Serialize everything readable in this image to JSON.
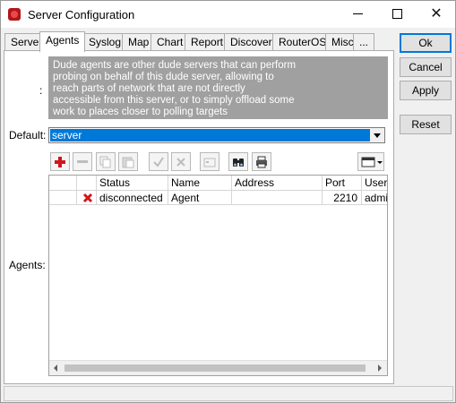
{
  "window": {
    "title": "Server Configuration"
  },
  "titlebar": {
    "minimize": "—",
    "maximize": "☐",
    "close": "✕"
  },
  "tabs": [
    {
      "label": "Server"
    },
    {
      "label": "Agents",
      "active": true
    },
    {
      "label": "Syslog"
    },
    {
      "label": "Map"
    },
    {
      "label": "Chart"
    },
    {
      "label": "Report"
    },
    {
      "label": "Discover"
    },
    {
      "label": "RouterOS"
    },
    {
      "label": "Misc"
    },
    {
      "label": "..."
    }
  ],
  "side_buttons": {
    "ok": "Ok",
    "cancel": "Cancel",
    "apply": "Apply",
    "reset": "Reset"
  },
  "info": {
    "label": ":",
    "lines": [
      "Dude agents are other dude servers that can perform",
      "probing on behalf of this dude server, allowing to",
      "reach parts of network that are not directly",
      "accessible from this server, or to simply offload some",
      "work to places closer to polling targets"
    ]
  },
  "default": {
    "label": "Default:",
    "value": "server"
  },
  "toolbar": {
    "add": "add-icon",
    "remove": "remove-icon",
    "copy": "copy-icon",
    "paste": "paste-icon",
    "enable": "check-icon",
    "disable": "cross-icon",
    "comment": "comment-icon",
    "find": "binoculars-icon",
    "print": "printer-icon",
    "columns": "columns-icon"
  },
  "agents": {
    "label": "Agents:",
    "columns": [
      "",
      "Status",
      "Name",
      "Address",
      "Port",
      "User"
    ],
    "rows": [
      {
        "status_icon": "error-x-icon",
        "status": "disconnected",
        "name": "Agent",
        "address": "",
        "port": "2210",
        "user": "admin"
      }
    ]
  },
  "colors": {
    "accent": "#0078d7",
    "info_bg": "#a0a0a0",
    "error": "#d0161c"
  }
}
